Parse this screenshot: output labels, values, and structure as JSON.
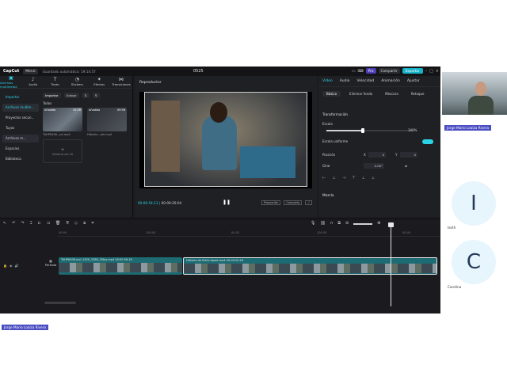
{
  "app": {
    "logo": "CapCut",
    "menu": "Menú",
    "autosave": "Guardado automático: 19:14:57",
    "project_title": "0525",
    "pro": "Pro",
    "share": "Compartir",
    "export": "Exportar"
  },
  "tools": [
    {
      "icon": "▣",
      "label": "Archivos multimedia"
    },
    {
      "icon": "♪",
      "label": "Audio"
    },
    {
      "icon": "T",
      "label": "Texto"
    },
    {
      "icon": "◔",
      "label": "Stickers"
    },
    {
      "icon": "✦",
      "label": "Efectos"
    },
    {
      "icon": "⋈",
      "label": "Transiciones"
    }
  ],
  "left_nav": [
    "Importar",
    "Archivos multim...",
    "Proyectos secun...",
    "Tuyos",
    "Archivos m...",
    "Espacios",
    "Biblioteca"
  ],
  "media": {
    "import_chip": "Importar",
    "record_chip": "Grabar",
    "section": "Todos",
    "thumbs": [
      {
        "badge": "Añadido",
        "duration": "10:18",
        "name": "TAHP6406...p4.mp4"
      },
      {
        "badge": "Añadido",
        "duration": "09:56",
        "name": "Historia...ple.mp4"
      }
    ],
    "generate_label": "Generar con IA"
  },
  "player": {
    "title": "Reproductor",
    "current_time": "00:00:54:13",
    "total_time": "00:09:20:04",
    "ratio_btn": "Proporción",
    "quality_btn": "Completa"
  },
  "inspector": {
    "tabs": [
      "Vídeo",
      "Audio",
      "Velocidad",
      "Animación",
      "Ajustar"
    ],
    "subtabs": [
      "Básico",
      "Eliminar fondo",
      "Máscara",
      "Retoque"
    ],
    "transform": "Transformación",
    "scale_label": "Escala",
    "scale_value": "100%",
    "scale_fraction": 0.42,
    "uniform_label": "Escala uniforme",
    "position_label": "Posición",
    "position_x_label": "X",
    "position_x": "0",
    "position_y_label": "Y",
    "position_y": "0",
    "rotate_label": "Girar",
    "rotate_value": "0.00°",
    "blend": "Mezcla"
  },
  "timeline": {
    "ruler": [
      "00:00",
      "100:00",
      "00:20",
      "100:30",
      "00:40"
    ],
    "cover": "Portada",
    "clip1_name": "TAHP6406.mvi_1920_1080_30fps.mp4   00:00:56:16",
    "clip2_name": "Historia de Estilo Apple.mp4   00:09:20:16"
  },
  "meeting": {
    "presenter_tag": "Jorge Mario Loaiza Rivera",
    "presenter_tag_bottom": "Jorge Mario Loaiza Rivera",
    "participants": [
      {
        "initial": "I",
        "name": "Iseth"
      },
      {
        "initial": "C",
        "name": "Carolina"
      }
    ]
  }
}
